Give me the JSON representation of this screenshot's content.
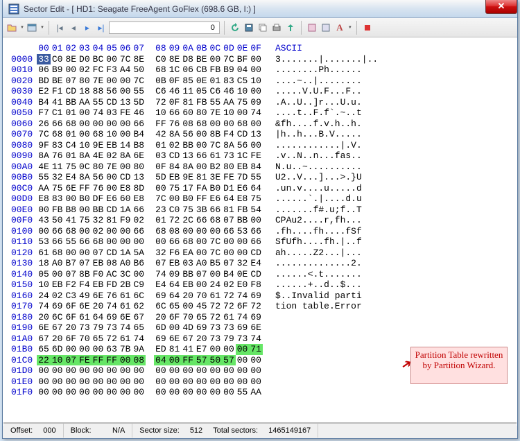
{
  "window": {
    "title": "Sector Edit - [ HD1: Seagate FreeAgent GoFlex (698.6 GB, I:) ]"
  },
  "toolbar": {
    "sector_value": "0"
  },
  "header": {
    "offsets": [
      "00",
      "01",
      "02",
      "03",
      "04",
      "05",
      "06",
      "07",
      "08",
      "09",
      "0A",
      "0B",
      "0C",
      "0D",
      "0E",
      "0F"
    ],
    "ascii_label": "ASCII"
  },
  "rows": [
    {
      "o": "0000",
      "h": [
        "33",
        "C0",
        "8E",
        "D0",
        "BC",
        "00",
        "7C",
        "8E",
        "C0",
        "8E",
        "D8",
        "BE",
        "00",
        "7C",
        "BF",
        "00"
      ],
      "a": "3.......|.......|.."
    },
    {
      "o": "0010",
      "h": [
        "06",
        "B9",
        "00",
        "02",
        "FC",
        "F3",
        "A4",
        "50",
        "68",
        "1C",
        "06",
        "CB",
        "FB",
        "B9",
        "04",
        "00"
      ],
      "a": "........Ph......"
    },
    {
      "o": "0020",
      "h": [
        "BD",
        "BE",
        "07",
        "80",
        "7E",
        "00",
        "00",
        "7C",
        "0B",
        "0F",
        "85",
        "0E",
        "01",
        "83",
        "C5",
        "10"
      ],
      "a": "....~..|........"
    },
    {
      "o": "0030",
      "h": [
        "E2",
        "F1",
        "CD",
        "18",
        "88",
        "56",
        "00",
        "55",
        "C6",
        "46",
        "11",
        "05",
        "C6",
        "46",
        "10",
        "00"
      ],
      "a": ".....V.U.F...F.."
    },
    {
      "o": "0040",
      "h": [
        "B4",
        "41",
        "BB",
        "AA",
        "55",
        "CD",
        "13",
        "5D",
        "72",
        "0F",
        "81",
        "FB",
        "55",
        "AA",
        "75",
        "09"
      ],
      "a": ".A..U..]r...U.u."
    },
    {
      "o": "0050",
      "h": [
        "F7",
        "C1",
        "01",
        "00",
        "74",
        "03",
        "FE",
        "46",
        "10",
        "66",
        "60",
        "80",
        "7E",
        "10",
        "00",
        "74"
      ],
      "a": "....t..F.f`.~..t"
    },
    {
      "o": "0060",
      "h": [
        "26",
        "66",
        "68",
        "00",
        "00",
        "00",
        "00",
        "66",
        "FF",
        "76",
        "08",
        "68",
        "00",
        "00",
        "68",
        "00"
      ],
      "a": "&fh....f.v.h..h."
    },
    {
      "o": "0070",
      "h": [
        "7C",
        "68",
        "01",
        "00",
        "68",
        "10",
        "00",
        "B4",
        "42",
        "8A",
        "56",
        "00",
        "8B",
        "F4",
        "CD",
        "13"
      ],
      "a": "|h..h...B.V....."
    },
    {
      "o": "0080",
      "h": [
        "9F",
        "83",
        "C4",
        "10",
        "9E",
        "EB",
        "14",
        "B8",
        "01",
        "02",
        "BB",
        "00",
        "7C",
        "8A",
        "56",
        "00"
      ],
      "a": "............|.V."
    },
    {
      "o": "0090",
      "h": [
        "8A",
        "76",
        "01",
        "8A",
        "4E",
        "02",
        "8A",
        "6E",
        "03",
        "CD",
        "13",
        "66",
        "61",
        "73",
        "1C",
        "FE"
      ],
      "a": ".v..N..n...fas.."
    },
    {
      "o": "00A0",
      "h": [
        "4E",
        "11",
        "75",
        "0C",
        "80",
        "7E",
        "00",
        "80",
        "0F",
        "84",
        "8A",
        "00",
        "B2",
        "80",
        "EB",
        "84"
      ],
      "a": "N.u..~.........."
    },
    {
      "o": "00B0",
      "h": [
        "55",
        "32",
        "E4",
        "8A",
        "56",
        "00",
        "CD",
        "13",
        "5D",
        "EB",
        "9E",
        "81",
        "3E",
        "FE",
        "7D",
        "55"
      ],
      "a": "U2..V...]...>.}U"
    },
    {
      "o": "00C0",
      "h": [
        "AA",
        "75",
        "6E",
        "FF",
        "76",
        "00",
        "E8",
        "8D",
        "00",
        "75",
        "17",
        "FA",
        "B0",
        "D1",
        "E6",
        "64"
      ],
      "a": ".un.v....u.....d"
    },
    {
      "o": "00D0",
      "h": [
        "E8",
        "83",
        "00",
        "B0",
        "DF",
        "E6",
        "60",
        "E8",
        "7C",
        "00",
        "B0",
        "FF",
        "E6",
        "64",
        "E8",
        "75"
      ],
      "a": "......`.|....d.u"
    },
    {
      "o": "00E0",
      "h": [
        "00",
        "FB",
        "B8",
        "00",
        "BB",
        "CD",
        "1A",
        "66",
        "23",
        "C0",
        "75",
        "3B",
        "66",
        "81",
        "FB",
        "54"
      ],
      "a": ".......f#.u;f..T"
    },
    {
      "o": "00F0",
      "h": [
        "43",
        "50",
        "41",
        "75",
        "32",
        "81",
        "F9",
        "02",
        "01",
        "72",
        "2C",
        "66",
        "68",
        "07",
        "BB",
        "00"
      ],
      "a": "CPAu2....r,fh..."
    },
    {
      "o": "0100",
      "h": [
        "00",
        "66",
        "68",
        "00",
        "02",
        "00",
        "00",
        "66",
        "68",
        "08",
        "00",
        "00",
        "00",
        "66",
        "53",
        "66"
      ],
      "a": ".fh....fh....fSf"
    },
    {
      "o": "0110",
      "h": [
        "53",
        "66",
        "55",
        "66",
        "68",
        "00",
        "00",
        "00",
        "00",
        "66",
        "68",
        "00",
        "7C",
        "00",
        "00",
        "66"
      ],
      "a": "SfUfh....fh.|..f"
    },
    {
      "o": "0120",
      "h": [
        "61",
        "68",
        "00",
        "00",
        "07",
        "CD",
        "1A",
        "5A",
        "32",
        "F6",
        "EA",
        "00",
        "7C",
        "00",
        "00",
        "CD"
      ],
      "a": "ah.....Z2...|..."
    },
    {
      "o": "0130",
      "h": [
        "18",
        "A0",
        "B7",
        "07",
        "EB",
        "08",
        "A0",
        "B6",
        "07",
        "EB",
        "03",
        "A0",
        "B5",
        "07",
        "32",
        "E4"
      ],
      "a": "..............2."
    },
    {
      "o": "0140",
      "h": [
        "05",
        "00",
        "07",
        "8B",
        "F0",
        "AC",
        "3C",
        "00",
        "74",
        "09",
        "BB",
        "07",
        "00",
        "B4",
        "0E",
        "CD"
      ],
      "a": "......<.t......."
    },
    {
      "o": "0150",
      "h": [
        "10",
        "EB",
        "F2",
        "F4",
        "EB",
        "FD",
        "2B",
        "C9",
        "E4",
        "64",
        "EB",
        "00",
        "24",
        "02",
        "E0",
        "F8"
      ],
      "a": "......+..d..$..."
    },
    {
      "o": "0160",
      "h": [
        "24",
        "02",
        "C3",
        "49",
        "6E",
        "76",
        "61",
        "6C",
        "69",
        "64",
        "20",
        "70",
        "61",
        "72",
        "74",
        "69"
      ],
      "a": "$..Invalid parti"
    },
    {
      "o": "0170",
      "h": [
        "74",
        "69",
        "6F",
        "6E",
        "20",
        "74",
        "61",
        "62",
        "6C",
        "65",
        "00",
        "45",
        "72",
        "72",
        "6F",
        "72"
      ],
      "a": "tion table.Error"
    },
    {
      "o": "0180",
      "h": [
        "20",
        "6C",
        "6F",
        "61",
        "64",
        "69",
        "6E",
        "67",
        "20",
        "6F",
        "70",
        "65",
        "72",
        "61",
        "74",
        "69"
      ],
      "a": ""
    },
    {
      "o": "0190",
      "h": [
        "6E",
        "67",
        "20",
        "73",
        "79",
        "73",
        "74",
        "65",
        "6D",
        "00",
        "4D",
        "69",
        "73",
        "73",
        "69",
        "6E"
      ],
      "a": ""
    },
    {
      "o": "01A0",
      "h": [
        "67",
        "20",
        "6F",
        "70",
        "65",
        "72",
        "61",
        "74",
        "69",
        "6E",
        "67",
        "20",
        "73",
        "79",
        "73",
        "74"
      ],
      "a": ""
    },
    {
      "o": "01B0",
      "h": [
        "65",
        "6D",
        "00",
        "00",
        "00",
        "63",
        "7B",
        "9A",
        "ED",
        "81",
        "41",
        "E7",
        "00",
        "00",
        "00",
        "71"
      ],
      "a": ""
    },
    {
      "o": "01C0",
      "h": [
        "22",
        "10",
        "07",
        "FE",
        "FF",
        "FF",
        "00",
        "08",
        "04",
        "00",
        "FF",
        "57",
        "50",
        "57",
        "00",
        "00"
      ],
      "a": ""
    },
    {
      "o": "01D0",
      "h": [
        "00",
        "00",
        "00",
        "00",
        "00",
        "00",
        "00",
        "00",
        "00",
        "00",
        "00",
        "00",
        "00",
        "00",
        "00",
        "00"
      ],
      "a": ""
    },
    {
      "o": "01E0",
      "h": [
        "00",
        "00",
        "00",
        "00",
        "00",
        "00",
        "00",
        "00",
        "00",
        "00",
        "00",
        "00",
        "00",
        "00",
        "00",
        "00"
      ],
      "a": ""
    },
    {
      "o": "01F0",
      "h": [
        "00",
        "00",
        "00",
        "00",
        "00",
        "00",
        "00",
        "00",
        "00",
        "00",
        "00",
        "00",
        "00",
        "00",
        "55",
        "AA"
      ],
      "a": ""
    }
  ],
  "highlight": {
    "sel_row": 0,
    "sel_col": 0,
    "green_start_row": 27,
    "green_start_col": 14,
    "green_end_row": 28,
    "green_end_col": 13
  },
  "annotation": {
    "text": "Partition Table rewritten by Partition Wizard."
  },
  "status": {
    "offset_label": "Offset:",
    "offset_val": "000",
    "block_label": "Block:",
    "block_val": "N/A",
    "sector_size_label": "Sector size:",
    "sector_size_val": "512",
    "total_sectors_label": "Total sectors:",
    "total_sectors_val": "1465149167"
  }
}
